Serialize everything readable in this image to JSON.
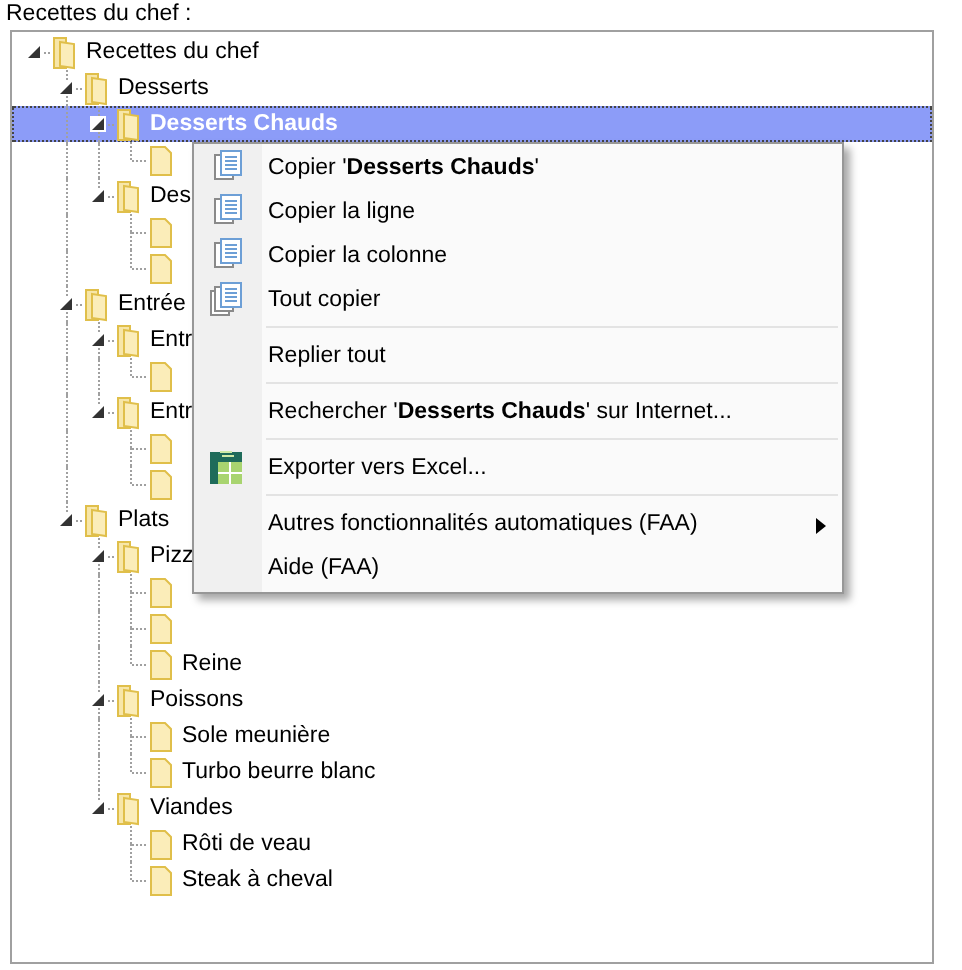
{
  "tree_label": "Recettes du chef :",
  "tree": [
    {
      "label": "Recettes du chef",
      "expanded": true,
      "selected": false,
      "children": [
        {
          "label": "Desserts",
          "expanded": true,
          "selected": false,
          "children": [
            {
              "label": "Desserts Chauds",
              "expanded": true,
              "selected": true,
              "children": [
                {
                  "selected": false
                }
              ]
            },
            {
              "label": "Des",
              "expanded": true,
              "selected": false,
              "children": [
                {
                  "selected": false
                },
                {
                  "selected": false
                }
              ]
            }
          ]
        },
        {
          "label": "Entrée",
          "expanded": true,
          "selected": false,
          "children": [
            {
              "label": "Entr",
              "expanded": true,
              "selected": false,
              "children": [
                {
                  "selected": false
                }
              ]
            },
            {
              "label": "Entr",
              "expanded": true,
              "selected": false,
              "children": [
                {
                  "selected": false
                },
                {
                  "selected": false
                }
              ]
            }
          ]
        },
        {
          "label": "Plats",
          "expanded": true,
          "selected": false,
          "children": [
            {
              "label": "Pizz",
              "expanded": true,
              "selected": false,
              "children": [
                {
                  "selected": false
                },
                {
                  "selected": false
                },
                {
                  "label": "Reine",
                  "selected": false
                }
              ]
            },
            {
              "label": "Poissons",
              "expanded": true,
              "selected": false,
              "children": [
                {
                  "label": "Sole meunière",
                  "selected": false
                },
                {
                  "label": "Turbo beurre blanc",
                  "selected": false
                }
              ]
            },
            {
              "label": "Viandes",
              "expanded": true,
              "selected": false,
              "children": [
                {
                  "label": "Rôti de veau",
                  "selected": false
                },
                {
                  "label": "Steak à cheval",
                  "selected": false
                }
              ]
            }
          ]
        }
      ]
    }
  ],
  "context_menu": [
    {
      "label": "Copier '**Desserts Chauds**'",
      "kind": "copy"
    },
    {
      "label": "Copier la ligne",
      "kind": "copy"
    },
    {
      "label": "Copier la colonne",
      "kind": "copy"
    },
    {
      "label": "Tout copier",
      "kind": "copy_all"
    },
    {
      "label": "Replier tout",
      "kind": "plain",
      "separator_before": true
    },
    {
      "label": "Rechercher '**Desserts Chauds**' sur Internet...",
      "kind": "plain",
      "separator_before": true
    },
    {
      "label": "Exporter vers Excel...",
      "kind": "excel",
      "separator_before": true
    },
    {
      "label": "Autres fonctionnalités automatiques (FAA)",
      "kind": "submenu",
      "separator_before": true
    },
    {
      "label": "Aide (FAA)",
      "kind": "plain"
    }
  ]
}
